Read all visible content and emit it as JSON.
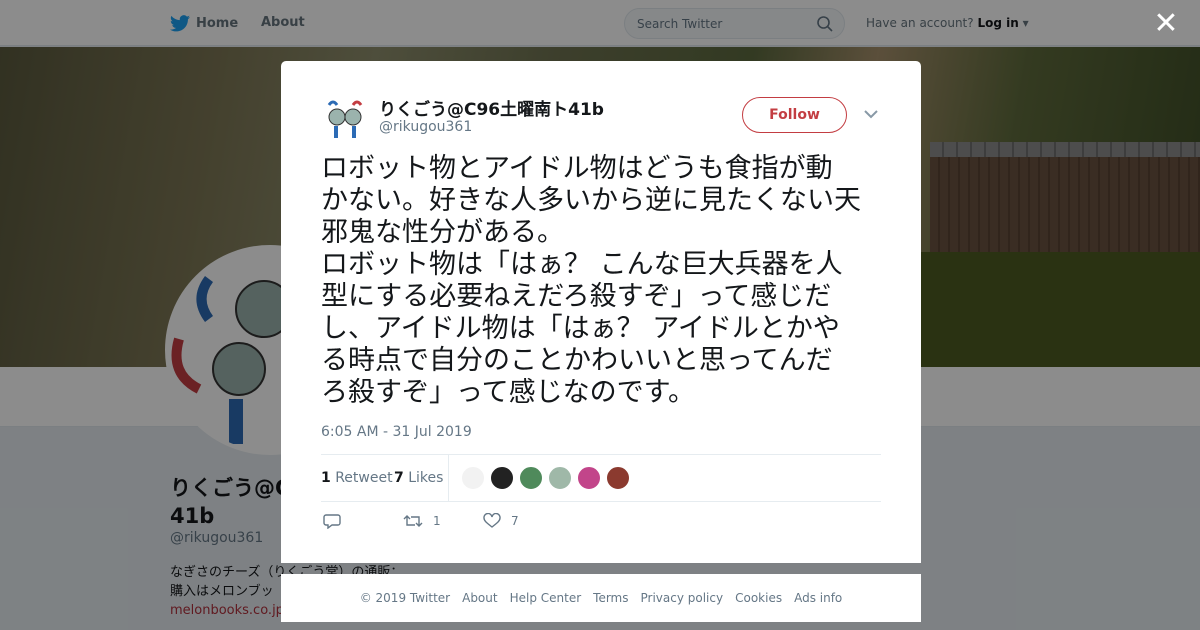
{
  "nav": {
    "home_label": "Home",
    "about_label": "About",
    "search_placeholder": "Search Twitter",
    "account_prompt": "Have an account?",
    "login_label": "Log in"
  },
  "profile": {
    "name_line1": "りくごう@C",
    "name_line2": "41b",
    "handle": "@rikugou361",
    "bio_line1": "なぎさのチーズ（りくごう堂）の通販：",
    "bio_line2": "購入はメロンブッ",
    "bio_link": "melonbooks.co.jp"
  },
  "tweet": {
    "display_name": "りくごう@C96土曜南ト41b",
    "screen_name": "@rikugou361",
    "follow_label": "Follow",
    "text": "ロボット物とアイドル物はどうも食指が動\nかない。好きな人多いから逆に見たくない天\n邪鬼な性分がある。\nロボット物は「はぁ？ こんな巨大兵器を人\n型にする必要ねえだろ殺すぞ」って感じだ\nし、アイドル物は「はぁ？ アイドルとかや\nる時点で自分のことかわいいと思ってんだ\nろ殺すぞ」って感じなのです。",
    "timestamp": "6:05 AM - 31 Jul 2019",
    "retweet_count": "1",
    "retweet_label": "Retweet",
    "like_count": "7",
    "like_label": "Likes",
    "action_retweet_count": "1",
    "action_like_count": "7"
  },
  "likers": [
    {
      "icon": "avatar-1",
      "color": "#f2f2f2"
    },
    {
      "icon": "avatar-2",
      "color": "#222222"
    },
    {
      "icon": "avatar-3",
      "color": "#4f8a5b"
    },
    {
      "icon": "avatar-4",
      "color": "#9fb8a8"
    },
    {
      "icon": "avatar-5",
      "color": "#c2458a"
    },
    {
      "icon": "avatar-6",
      "color": "#8b3a2f"
    }
  ],
  "footer": {
    "links": [
      "© 2019 Twitter",
      "About",
      "Help Center",
      "Terms",
      "Privacy policy",
      "Cookies",
      "Ads info"
    ]
  },
  "colors": {
    "accent": "#c33d42",
    "twitter_blue": "#1da1f2"
  }
}
